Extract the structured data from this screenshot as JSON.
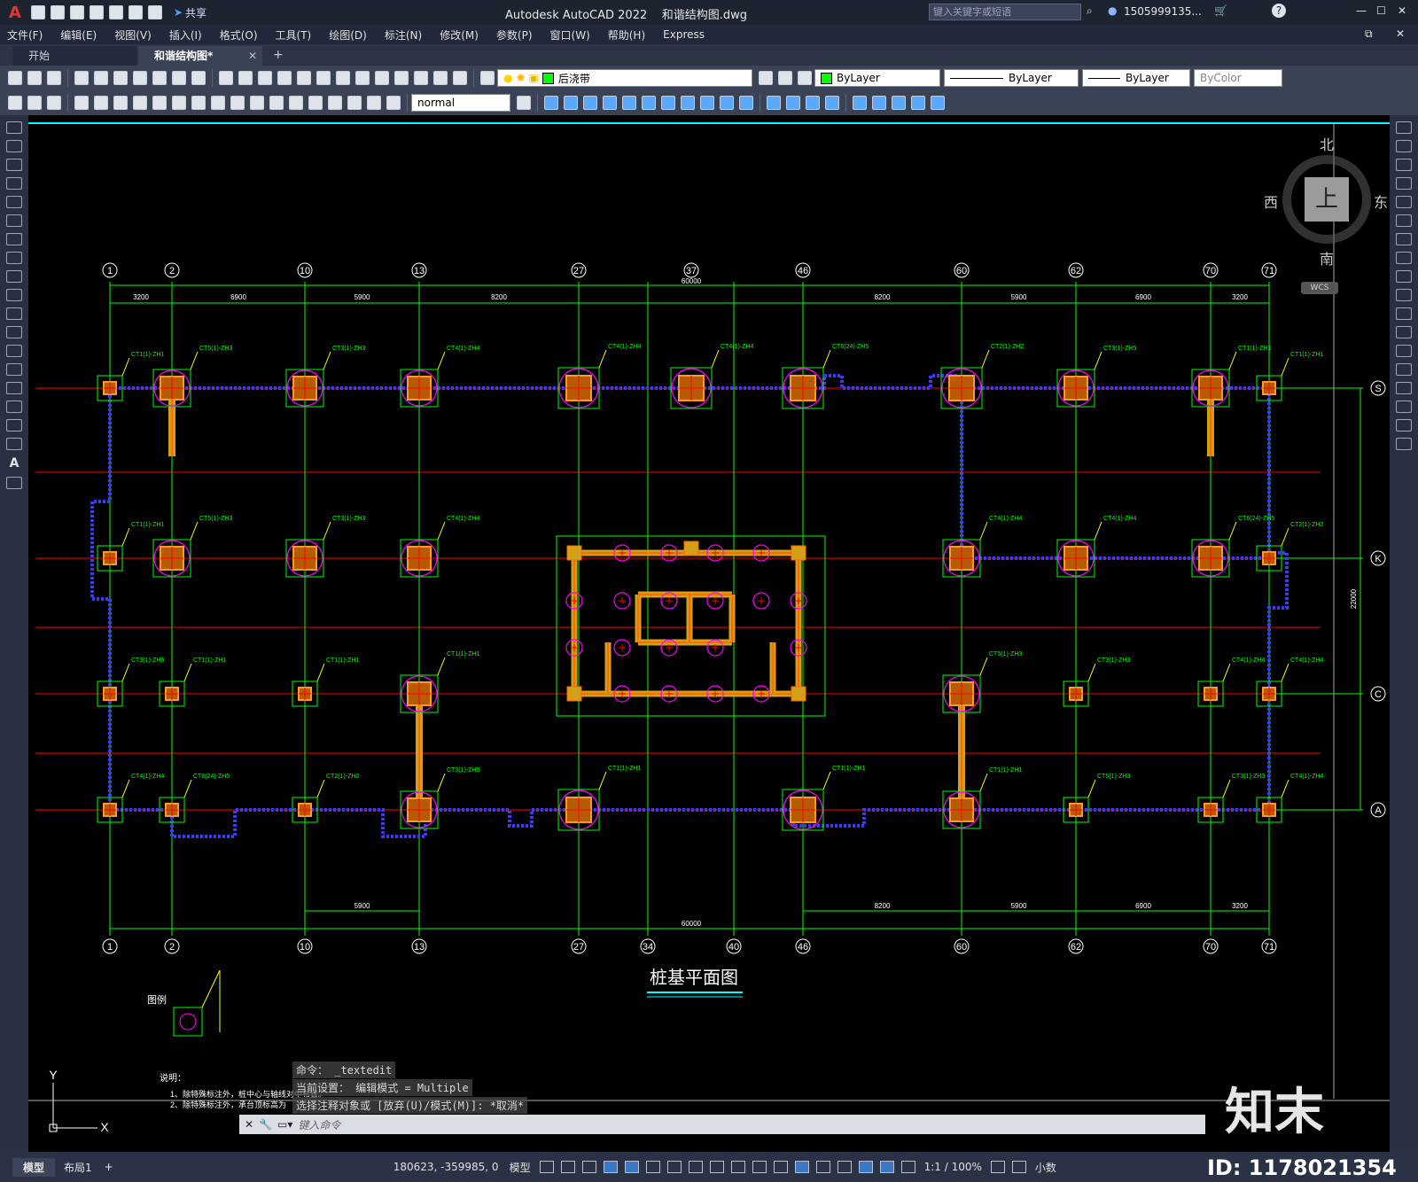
{
  "app": {
    "logo": "A",
    "title": "Autodesk AutoCAD 2022    和谐结构图.dwg",
    "share_label": "共享",
    "search_placeholder": "键入关键字或短语",
    "user": "1505999135...",
    "window_buttons": [
      "—",
      "☐",
      "✕"
    ]
  },
  "menu": [
    "文件(F)",
    "编辑(E)",
    "视图(V)",
    "插入(I)",
    "格式(O)",
    "工具(T)",
    "绘图(D)",
    "标注(N)",
    "修改(M)",
    "参数(P)",
    "窗口(W)",
    "帮助(H)",
    "Express"
  ],
  "tabs": [
    {
      "label": "开始",
      "active": false
    },
    {
      "label": "和谐结构图*",
      "active": true
    }
  ],
  "toolbar": {
    "layer": "后浇带",
    "color": "ByLayer",
    "linetype": "ByLayer",
    "lineweight": "ByLayer",
    "plotstyle": "ByColor",
    "textstyle": "normal"
  },
  "viewcube": {
    "north": "北",
    "south": "南",
    "east": "东",
    "west": "西",
    "top": "上",
    "wcs": "WCS"
  },
  "drawing": {
    "title": "桩基平面图",
    "legend_title": "图例",
    "notes_title": "说明：",
    "notes": [
      "1、除特殊标注外，桩中心与轴线对中布置。",
      "2、除特殊标注外，承台顶标高为"
    ],
    "axis_top": [
      "1",
      "2",
      "10",
      "13",
      "27",
      "37",
      "46",
      "60",
      "62",
      "70",
      "71"
    ],
    "axis_bottom": [
      "1",
      "2",
      "10",
      "13",
      "27",
      "34",
      "40",
      "46",
      "60",
      "62",
      "70",
      "71"
    ],
    "axis_right": [
      "S",
      "K",
      "C",
      "A"
    ],
    "dims_top": [
      "3200",
      "6900",
      "5900",
      "8200",
      "8200",
      "5900",
      "6900",
      "3200"
    ],
    "dims_bottom": [
      "5900",
      "8200",
      "5900",
      "6900",
      "3200"
    ],
    "total_dim": "60000",
    "right_dim": "22000",
    "pile_labels": [
      "CT1(1)-ZH1",
      "CT5(1)-ZH3",
      "CT3(1)-ZH3",
      "CT4(1)-ZH4",
      "CT4(1)-ZH4",
      "CT4(1)-ZH4",
      "CT6(24)-ZH5",
      "CT2(1)-ZH2",
      "CT3(1)-ZH5",
      "CT1(1)-ZH1",
      "CT1(1)-ZH1"
    ]
  },
  "command": {
    "history": [
      "命令： _textedit",
      "当前设置： 编辑模式 = Multiple",
      "选择注释对象或 [放弃(U)/模式(M)]: *取消*"
    ],
    "placeholder": "键入命令"
  },
  "status": {
    "layout_tabs": [
      "模型",
      "布局1"
    ],
    "coords": "180623, -359985, 0",
    "model": "模型",
    "scale": "1:1 / 100%",
    "units": "小数"
  },
  "watermark": {
    "brand": "知末",
    "id": "ID: 1178021354"
  }
}
